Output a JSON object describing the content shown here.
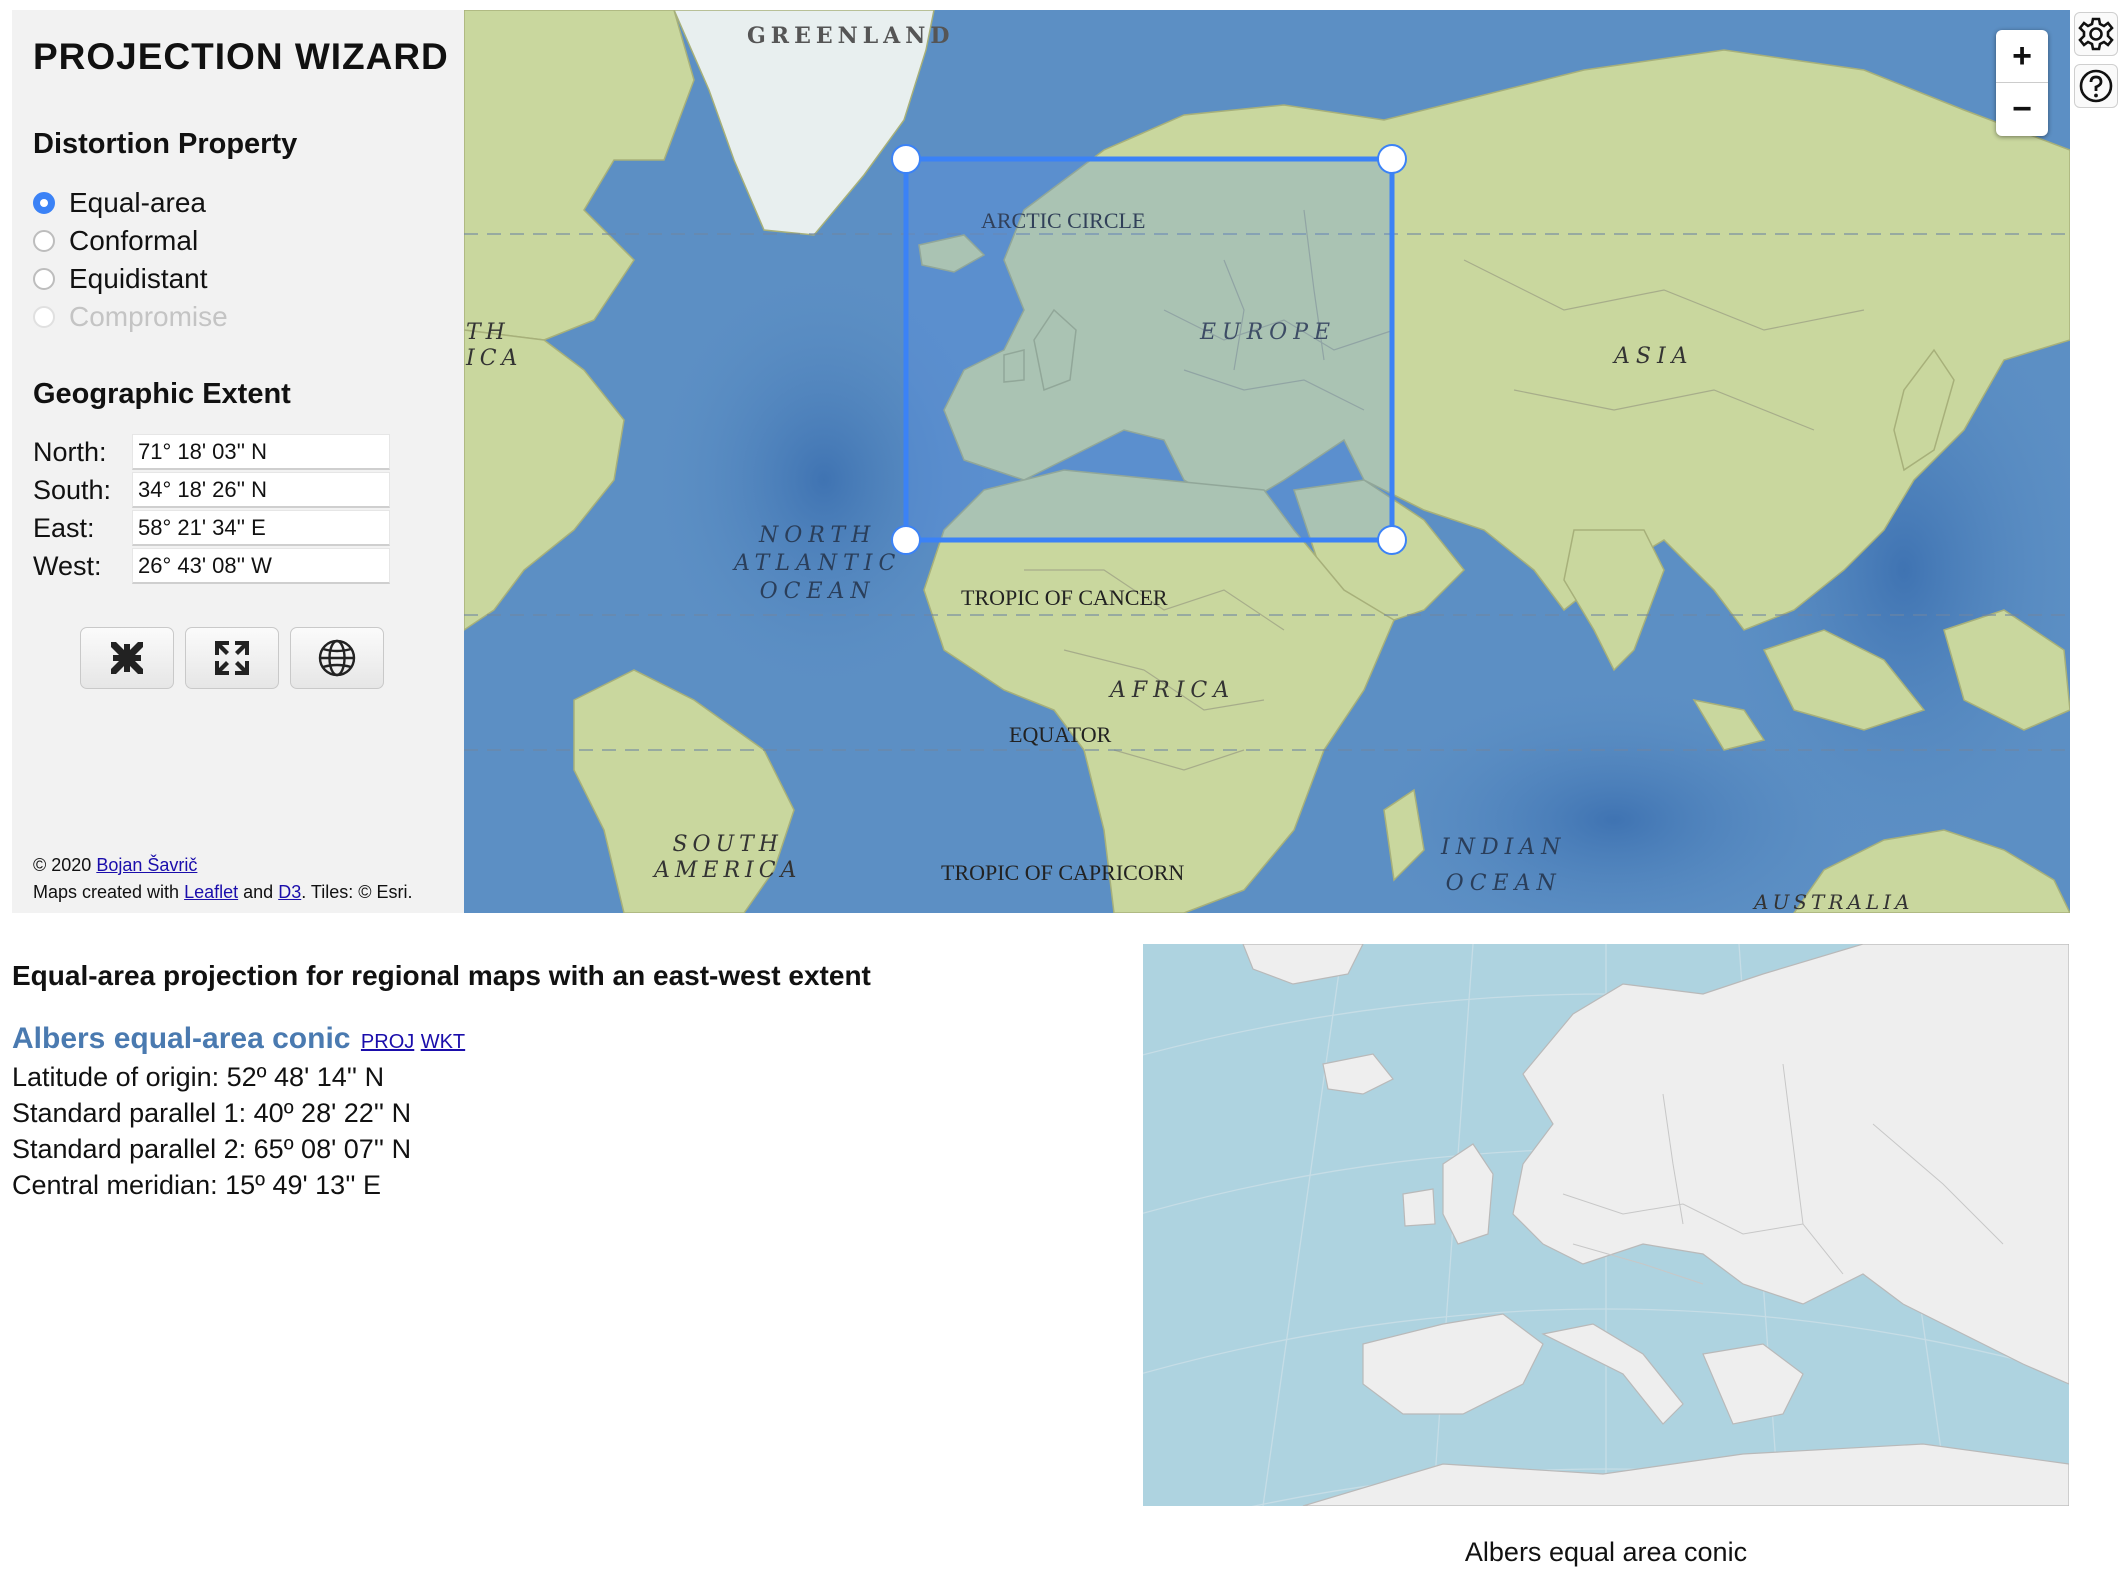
{
  "app": {
    "title": "PROJECTION WIZARD"
  },
  "distortion": {
    "heading": "Distortion Property",
    "options": [
      {
        "label": "Equal-area",
        "selected": true,
        "disabled": false
      },
      {
        "label": "Conformal",
        "selected": false,
        "disabled": false
      },
      {
        "label": "Equidistant",
        "selected": false,
        "disabled": false
      },
      {
        "label": "Compromise",
        "selected": false,
        "disabled": true
      }
    ]
  },
  "extent": {
    "heading": "Geographic Extent",
    "north": {
      "label": "North:",
      "value": "71° 18' 03'' N"
    },
    "south": {
      "label": "South:",
      "value": "34° 18' 26'' N"
    },
    "east": {
      "label": "East:",
      "value": "58° 21' 34'' E"
    },
    "west": {
      "label": "West:",
      "value": "26° 43' 08'' W"
    }
  },
  "tools": [
    "collapse-arrows-icon",
    "expand-arrows-icon",
    "globe-icon"
  ],
  "footer": {
    "copyright": "© 2020",
    "author": "Bojan Šavrič",
    "maps_prefix": "Maps created with",
    "leaflet": "Leaflet",
    "and": "and",
    "d3": "D3",
    "tiles": ". Tiles: © Esri."
  },
  "map": {
    "labels": {
      "greenland": "GREENLAND",
      "arctic_circle": "ARCTIC CIRCLE",
      "europe": "EUROPE",
      "asia": "ASIA",
      "north_atlantic": [
        "NORTH",
        "ATLANTIC",
        "OCEAN"
      ],
      "america_fragment": [
        "TH",
        "ICA"
      ],
      "tropic_cancer": "TROPIC OF CANCER",
      "africa": "AFRICA",
      "equator": "EQUATOR",
      "south_america": [
        "SOUTH",
        "AMERICA"
      ],
      "tropic_capricorn": "TROPIC OF CAPRICORN",
      "indian_ocean": [
        "INDIAN",
        "OCEAN"
      ],
      "australia": "AUSTRALIA"
    },
    "zoom_in": "+",
    "zoom_out": "−",
    "colors": {
      "ocean": "#5c8fc4",
      "land": "#c9d79e",
      "selection": "#3b82f6"
    }
  },
  "side_icons": [
    "gear-icon",
    "help-icon"
  ],
  "result": {
    "heading": "Equal-area projection for regional maps with an east-west extent",
    "projection": "Albers equal-area conic",
    "proj_link": "PROJ",
    "wkt_link": "WKT",
    "params": [
      "Latitude of origin: 52º 48' 14'' N",
      "Standard parallel 1: 40º 28' 22'' N",
      "Standard parallel 2: 65º 08' 07'' N",
      "Central meridian: 15º 49' 13'' E"
    ],
    "preview_caption": "Albers equal area conic"
  }
}
